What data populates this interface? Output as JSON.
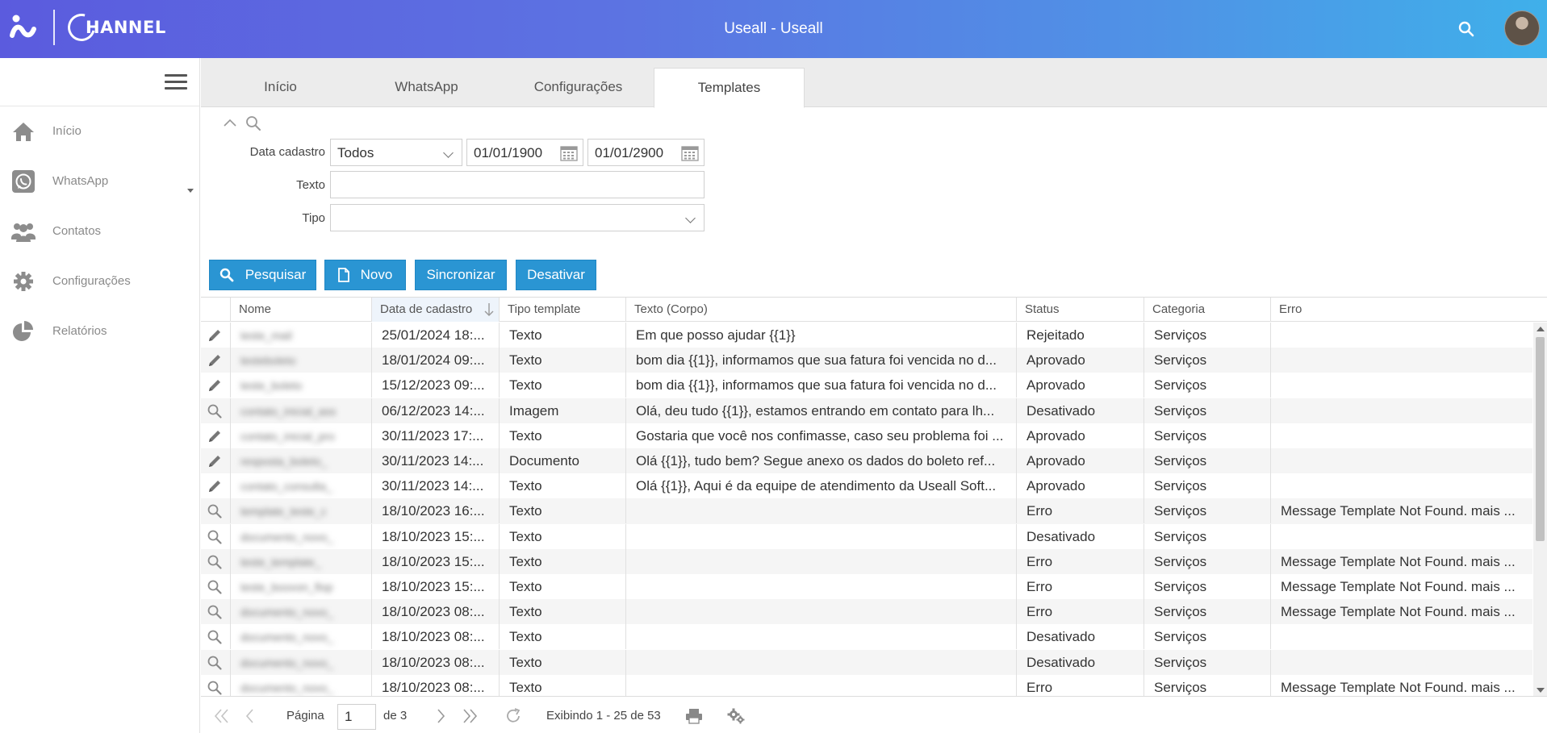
{
  "header": {
    "title": "Useall - Useall",
    "logo_text": "HANNEL",
    "search_icon": "search-icon",
    "avatar_icon": "user-avatar"
  },
  "sidebar": {
    "items": [
      {
        "label": "Início",
        "icon": "home-icon"
      },
      {
        "label": "WhatsApp",
        "icon": "whatsapp-icon"
      },
      {
        "label": "Contatos",
        "icon": "users-icon"
      },
      {
        "label": "Configurações",
        "icon": "gear-icon"
      },
      {
        "label": "Relatórios",
        "icon": "pie-chart-icon"
      }
    ]
  },
  "tabs": [
    {
      "label": "Início",
      "active": false
    },
    {
      "label": "WhatsApp",
      "active": false
    },
    {
      "label": "Configurações",
      "active": false
    },
    {
      "label": "Templates",
      "active": true
    }
  ],
  "filters": {
    "data_cadastro_label": "Data cadastro",
    "data_cadastro_value": "Todos",
    "date_from": "01/01/1900",
    "date_to": "01/01/2900",
    "texto_label": "Texto",
    "texto_value": "",
    "tipo_label": "Tipo",
    "tipo_value": ""
  },
  "buttons": {
    "pesquisar": "Pesquisar",
    "novo": "Novo",
    "sincronizar": "Sincronizar",
    "desativar": "Desativar"
  },
  "colors": {
    "primary_button": "#2a95d3",
    "header_start": "#5b5bde",
    "header_end": "#3fb0ea"
  },
  "grid": {
    "columns": [
      "Nome",
      "Data de cadastro",
      "Tipo template",
      "Texto (Corpo)",
      "Status",
      "Categoria",
      "Erro"
    ],
    "sorted_column": "Data de cadastro",
    "rows": [
      {
        "action": "edit",
        "nome": "teste_mail",
        "data": "25/01/2024 18:...",
        "tipo": "Texto",
        "texto": "Em que posso ajudar {{1}}",
        "status": "Rejeitado",
        "categoria": "Serviços",
        "erro": ""
      },
      {
        "action": "edit",
        "nome": "testeboleto",
        "data": "18/01/2024 09:...",
        "tipo": "Texto",
        "texto": "bom dia {{1}}, informamos que sua fatura foi vencida no d...",
        "status": "Aprovado",
        "categoria": "Serviços",
        "erro": ""
      },
      {
        "action": "edit",
        "nome": "teste_boleto",
        "data": "15/12/2023 09:...",
        "tipo": "Texto",
        "texto": "bom dia {{1}}, informamos que sua fatura foi vencida no d...",
        "status": "Aprovado",
        "categoria": "Serviços",
        "erro": ""
      },
      {
        "action": "view",
        "nome": "contato_inicial_ass",
        "data": "06/12/2023 14:...",
        "tipo": "Imagem",
        "texto": "Olá, deu tudo {{1}}, estamos entrando em contato para lh...",
        "status": "Desativado",
        "categoria": "Serviços",
        "erro": ""
      },
      {
        "action": "edit",
        "nome": "contato_inicial_pro",
        "data": "30/11/2023 17:...",
        "tipo": "Texto",
        "texto": "Gostaria que você nos confimasse, caso seu problema foi ...",
        "status": "Aprovado",
        "categoria": "Serviços",
        "erro": ""
      },
      {
        "action": "edit",
        "nome": "resposta_boleto_",
        "data": "30/11/2023 14:...",
        "tipo": "Documento",
        "texto": "Olá {{1}}, tudo bem? Segue anexo os dados do boleto ref...",
        "status": "Aprovado",
        "categoria": "Serviços",
        "erro": ""
      },
      {
        "action": "edit",
        "nome": "contato_consulta_",
        "data": "30/11/2023 14:...",
        "tipo": "Texto",
        "texto": "Olá {{1}}, Aqui é da equipe de atendimento da Useall Soft...",
        "status": "Aprovado",
        "categoria": "Serviços",
        "erro": ""
      },
      {
        "action": "view",
        "nome": "template_teste_c",
        "data": "18/10/2023 16:...",
        "tipo": "Texto",
        "texto": "",
        "status": "Erro",
        "categoria": "Serviços",
        "erro": "Message Template Not Found. mais ..."
      },
      {
        "action": "view",
        "nome": "documento_novo_",
        "data": "18/10/2023 15:...",
        "tipo": "Texto",
        "texto": "",
        "status": "Desativado",
        "categoria": "Serviços",
        "erro": ""
      },
      {
        "action": "view",
        "nome": "teste_template_",
        "data": "18/10/2023 15:...",
        "tipo": "Texto",
        "texto": "",
        "status": "Erro",
        "categoria": "Serviços",
        "erro": "Message Template Not Found. mais ..."
      },
      {
        "action": "view",
        "nome": "teste_boovon_flop",
        "data": "18/10/2023 15:...",
        "tipo": "Texto",
        "texto": "",
        "status": "Erro",
        "categoria": "Serviços",
        "erro": "Message Template Not Found. mais ..."
      },
      {
        "action": "view",
        "nome": "documento_novo_",
        "data": "18/10/2023 08:...",
        "tipo": "Texto",
        "texto": "",
        "status": "Erro",
        "categoria": "Serviços",
        "erro": "Message Template Not Found. mais ..."
      },
      {
        "action": "view",
        "nome": "documento_novo_",
        "data": "18/10/2023 08:...",
        "tipo": "Texto",
        "texto": "",
        "status": "Desativado",
        "categoria": "Serviços",
        "erro": ""
      },
      {
        "action": "view",
        "nome": "documento_novo_",
        "data": "18/10/2023 08:...",
        "tipo": "Texto",
        "texto": "",
        "status": "Desativado",
        "categoria": "Serviços",
        "erro": ""
      },
      {
        "action": "view",
        "nome": "documento_novo_",
        "data": "18/10/2023 08:...",
        "tipo": "Texto",
        "texto": "",
        "status": "Erro",
        "categoria": "Serviços",
        "erro": "Message Template Not Found. mais ..."
      }
    ]
  },
  "pager": {
    "page_label": "Página",
    "page_value": "1",
    "of_label": "de 3",
    "summary": "Exibindo 1 - 25 de 53"
  }
}
